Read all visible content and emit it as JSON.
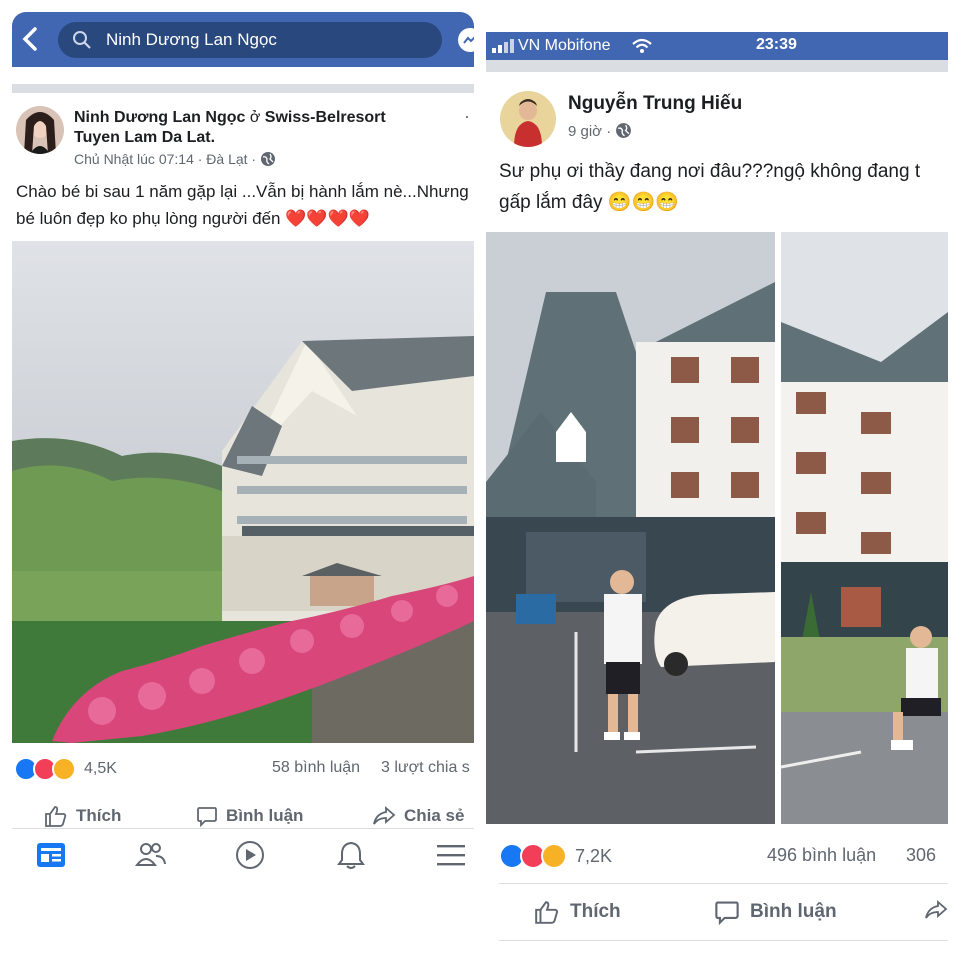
{
  "left": {
    "search": {
      "query": "Ninh Dương Lan Ngọc"
    },
    "post": {
      "author": "Ninh Dương Lan Ngọc",
      "at": "ở",
      "place": "Swiss-Belresort Tuyen Lam Da Lat.",
      "place_line2": "Tuyen Lam Da Lat.",
      "time": "Chủ Nhật lúc 07:14 · Đà Lạt ·",
      "text_line1": "Chào bé bi sau 1 năm gặp lại ...Vẫn bị hành lắm nè...Nhưng",
      "text_line2": "bé luôn đẹp ko phụ lòng người đến",
      "hearts": "❤️❤️❤️❤️",
      "reaction_count": "4,5K",
      "comments": "58 bình luận",
      "shares": "3 lượt chia s",
      "like_label": "Thích",
      "comment_label": "Bình luận",
      "share_label": "Chia sẻ"
    },
    "nav": [
      "news-feed-icon",
      "friends-icon",
      "watch-icon",
      "notifications-icon",
      "menu-icon"
    ]
  },
  "right": {
    "status": {
      "carrier": "VN Mobifone",
      "time": "23:39"
    },
    "post": {
      "author": "Nguyễn Trung Hiếu",
      "time": "9 giờ ·",
      "text_line1": "Sư phụ ơi thầy đang nơi đâu???ngộ không đang t",
      "text_line2": "gấp lắm đây",
      "emojis": "😁😁😁",
      "reaction_count": "7,2K",
      "comments": "496 bình luận",
      "shares": "306",
      "like_label": "Thích",
      "comment_label": "Bình luận"
    }
  },
  "colors": {
    "fb_blue": "#4267b2",
    "dark_blue": "#29487d",
    "meta_gray": "#606770",
    "like_blue": "#1877f2",
    "love_red": "#f33e58",
    "haha_yellow": "#f7b125"
  }
}
